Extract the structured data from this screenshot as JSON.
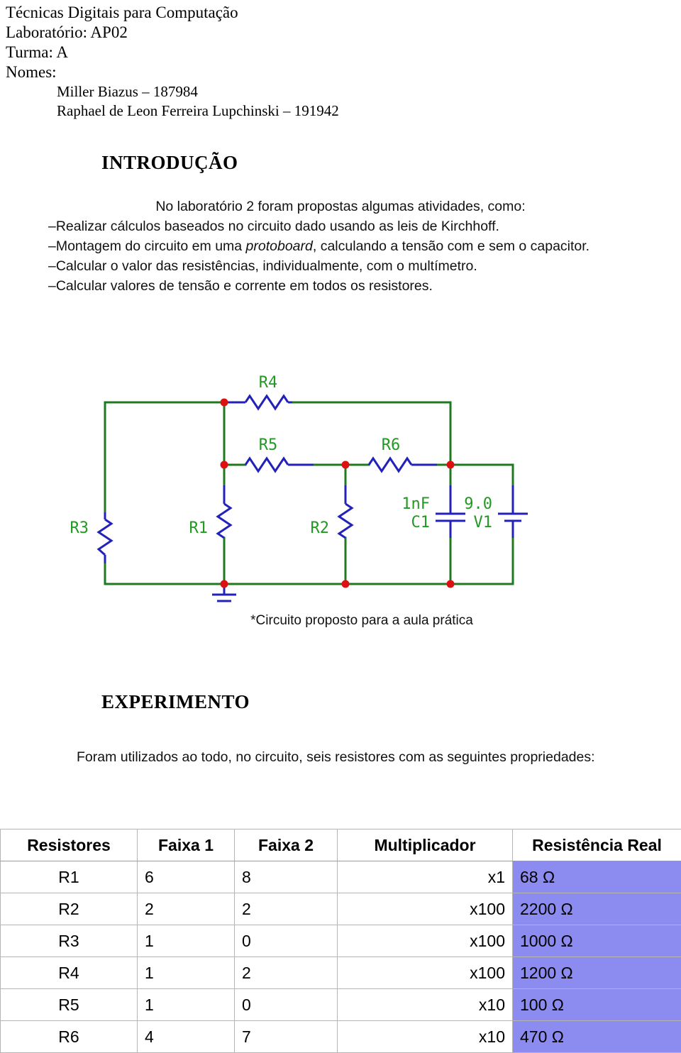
{
  "header": {
    "course": "Técnicas Digitais para Computação",
    "lab": "Laboratório: AP02",
    "class": "Turma: A",
    "names_label": "Nomes:",
    "names": [
      "Miller Biazus – 187984",
      "Raphael de Leon Ferreira Lupchinski – 191942"
    ]
  },
  "intro": {
    "heading": "INTRODUÇÃO",
    "lead": "No laboratório 2 foram propostas algumas atividades, como:",
    "items": [
      "–Realizar cálculos baseados no circuito dado usando as leis de Kirchhoff.",
      "–Montagem do circuito em uma protoboard, calculando a tensão com e sem o capacitor.",
      "–Calcular o valor das resistências, individualmente, com o multímetro.",
      "–Calcular valores de tensão e corrente em todos os resistores."
    ],
    "item2_prefix": "–Montagem do circuito em uma ",
    "item2_italic": "protoboard",
    "item2_suffix": ", calculando a tensão com e sem o capacitor."
  },
  "circuit": {
    "caption": "*Circuito proposto para a aula prática",
    "wire_color": "#1f7a1f",
    "component_color": "#2222bb",
    "node_color": "#dd1111",
    "label_color": "#229922",
    "labels": {
      "r1": "R1",
      "r2": "R2",
      "r3": "R3",
      "r4": "R4",
      "r5": "R5",
      "r6": "R6",
      "c1_value": "1nF",
      "c1_name": "C1",
      "v1_value": "9.0",
      "v1_name": "V1"
    }
  },
  "experimento": {
    "heading": "EXPERIMENTO",
    "paragraph": "Foram utilizados ao todo, no circuito, seis resistores com as seguintes propriedades:"
  },
  "table": {
    "headers": [
      "Resistores",
      "Faixa 1",
      "Faixa 2",
      "Multiplicador",
      "Resistência Real"
    ],
    "highlight_color": "#8c8cf0",
    "rows": [
      {
        "name": "R1",
        "band1": "6",
        "band2": "8",
        "mult": "x1",
        "real": "68 Ω"
      },
      {
        "name": "R2",
        "band1": "2",
        "band2": "2",
        "mult": "x100",
        "real": "2200 Ω"
      },
      {
        "name": "R3",
        "band1": "1",
        "band2": "0",
        "mult": "x100",
        "real": "1000 Ω"
      },
      {
        "name": "R4",
        "band1": "1",
        "band2": "2",
        "mult": "x100",
        "real": "1200 Ω"
      },
      {
        "name": "R5",
        "band1": "1",
        "band2": "0",
        "mult": "x10",
        "real": "100 Ω"
      },
      {
        "name": "R6",
        "band1": "4",
        "band2": "7",
        "mult": "x10",
        "real": "470 Ω"
      }
    ]
  }
}
